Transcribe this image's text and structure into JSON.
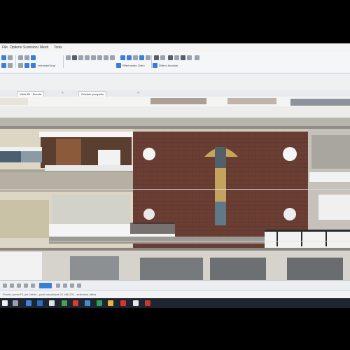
{
  "menu": {
    "items": [
      "File",
      "Options",
      "Scansioni",
      "Mesh",
      "Tools"
    ]
  },
  "ribbon": {
    "labels": [
      "Intensita/Grigi",
      "Riferimento Ortho",
      "Rilievo facciata"
    ]
  },
  "tabs": [
    {
      "label": "Vista 3D - Nuvola"
    },
    {
      "label": "Ortofoto prospetto"
    }
  ],
  "status": {
    "text": "Pronto: premi F1 per l'aiuto - punti visualizzati 12 458 201 - selezione attiva"
  },
  "colors": {
    "accent": "#3a7fd5",
    "brick": "#6a3e33",
    "taskbar": "#1f2530"
  },
  "icons": {
    "taskbar": [
      "windows-icon",
      "search-icon",
      "folder-icon",
      "browser-icon",
      "mail-icon",
      "app-icon",
      "app-icon",
      "app-icon",
      "pdf-icon",
      "app-icon",
      "app-icon"
    ]
  }
}
